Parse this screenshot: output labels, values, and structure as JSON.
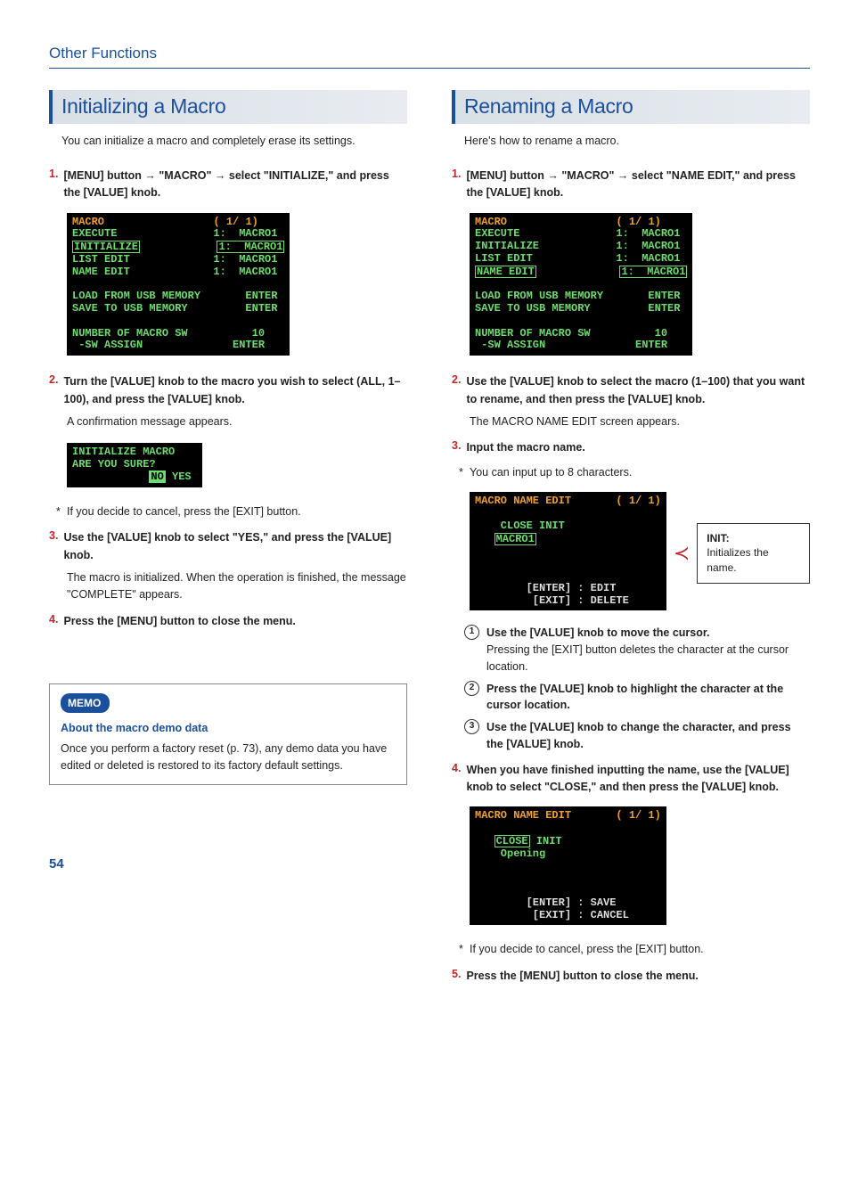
{
  "header": "Other Functions",
  "page_number": "54",
  "left": {
    "title": "Initializing a Macro",
    "intro": "You can initialize a macro and completely erase its settings.",
    "step1": "[MENU] button → \"MACRO\" → select \"INITIALIZE,\" and press the [VALUE] knob.",
    "screen1": {
      "title": "MACRO",
      "page": "( 1/ 1)",
      "rows": [
        {
          "l": "EXECUTE",
          "r": "1:  MACRO1"
        },
        {
          "l": "INITIALIZE",
          "r": "1:  MACRO1",
          "boxed": true
        },
        {
          "l": "LIST EDIT",
          "r": "1:  MACRO1"
        },
        {
          "l": "NAME EDIT",
          "r": "1:  MACRO1"
        }
      ],
      "mid": [
        {
          "l": "LOAD FROM USB MEMORY",
          "r": "ENTER"
        },
        {
          "l": "SAVE TO USB MEMORY",
          "r": "ENTER"
        }
      ],
      "bot": [
        {
          "l": "NUMBER OF MACRO SW",
          "r": "10"
        },
        {
          "l": " -SW ASSIGN",
          "r": "ENTER"
        }
      ]
    },
    "step2": "Turn the [VALUE] knob to the macro you wish to select (ALL, 1–100), and press the [VALUE] knob.",
    "step2sub": "A confirmation message appears.",
    "screen2": {
      "l1": "INITIALIZE MACRO",
      "l2": "ARE YOU SURE?",
      "no": "NO",
      "yes": "YES"
    },
    "note_cancel": "If you decide to cancel, press the [EXIT] button.",
    "step3": "Use the [VALUE] knob to select \"YES,\" and press the [VALUE] knob.",
    "step3sub": "The macro is initialized. When the operation is finished, the message \"COMPLETE\" appears.",
    "step4": "Press the [MENU] button to close the menu.",
    "memo_badge": "MEMO",
    "memo_title": "About the macro demo data",
    "memo_body": "Once you perform a factory reset (p. 73), any demo data you have edited or deleted is restored to its factory default settings."
  },
  "right": {
    "title": "Renaming a Macro",
    "intro": "Here's how to rename a macro.",
    "step1": "[MENU] button → \"MACRO\" → select \"NAME EDIT,\" and press the [VALUE] knob.",
    "screen1": {
      "title": "MACRO",
      "page": "( 1/ 1)",
      "rows": [
        {
          "l": "EXECUTE",
          "r": "1:  MACRO1"
        },
        {
          "l": "INITIALIZE",
          "r": "1:  MACRO1"
        },
        {
          "l": "LIST EDIT",
          "r": "1:  MACRO1"
        },
        {
          "l": "NAME EDIT",
          "r": "1:  MACRO1",
          "boxed": true
        }
      ],
      "mid": [
        {
          "l": "LOAD FROM USB MEMORY",
          "r": "ENTER"
        },
        {
          "l": "SAVE TO USB MEMORY",
          "r": "ENTER"
        }
      ],
      "bot": [
        {
          "l": "NUMBER OF MACRO SW",
          "r": "10"
        },
        {
          "l": " -SW ASSIGN",
          "r": "ENTER"
        }
      ]
    },
    "step2": "Use the [VALUE] knob to select the macro (1–100) that you want to rename, and then press the [VALUE] knob.",
    "step2sub": "The MACRO NAME EDIT screen appears.",
    "step3": "Input the macro name.",
    "step3note": "You can input up to 8 characters.",
    "screen2": {
      "title": "MACRO NAME EDIT",
      "page": "( 1/ 1)",
      "line": "CLOSE INIT",
      "value": "MACRO1",
      "hint1": "[ENTER] : EDIT",
      "hint2": " [EXIT] : DELETE"
    },
    "callout_title": "INIT:",
    "callout_body": "Initializes the name.",
    "sub1": "Use the [VALUE] knob to move the cursor.",
    "sub1b": "Pressing the [EXIT] button deletes the character at the cursor location.",
    "sub2": "Press the [VALUE] knob to highlight the character at the cursor location.",
    "sub3": "Use the [VALUE] knob to change the character, and press the [VALUE] knob.",
    "step4": "When you have finished inputting the name, use the [VALUE] knob to select \"CLOSE,\" and then press the [VALUE] knob.",
    "screen3": {
      "title": "MACRO NAME EDIT",
      "page": "( 1/ 1)",
      "line_close": "CLOSE",
      "line_init": "INIT",
      "value": "Opening",
      "hint1": "[ENTER] : SAVE",
      "hint2": " [EXIT] : CANCEL"
    },
    "note_cancel": "If you decide to cancel, press the [EXIT] button.",
    "step5": "Press the [MENU] button to close the menu."
  }
}
